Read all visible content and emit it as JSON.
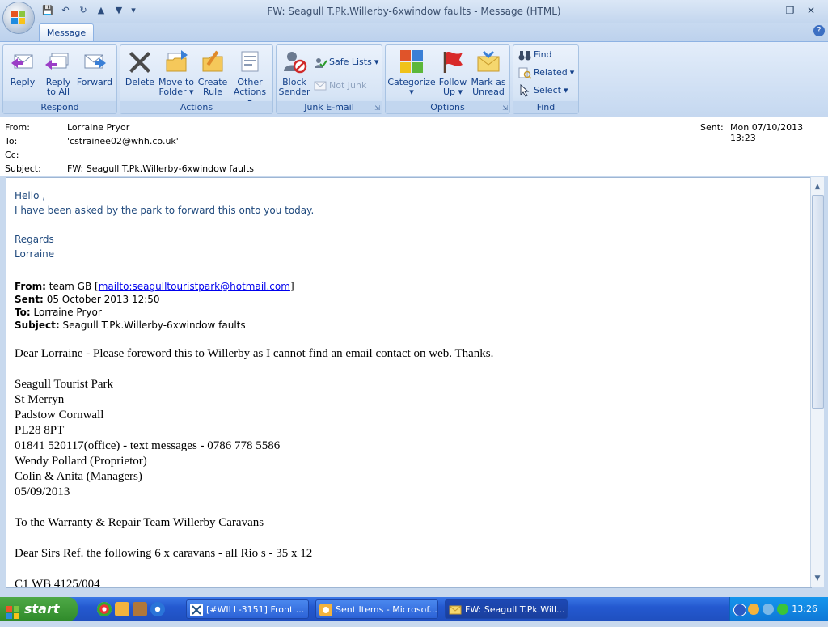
{
  "window": {
    "title": "FW: Seagull T.Pk.Willerby-6xwindow faults - Message (HTML)",
    "tab": "Message"
  },
  "ribbon": {
    "respond": {
      "label": "Respond",
      "reply": "Reply",
      "reply_all_1": "Reply",
      "reply_all_2": "to All",
      "forward": "Forward"
    },
    "actions": {
      "label": "Actions",
      "delete": "Delete",
      "move_1": "Move to",
      "move_2": "Folder",
      "create_1": "Create",
      "create_2": "Rule",
      "other_1": "Other",
      "other_2": "Actions"
    },
    "junk": {
      "label": "Junk E-mail",
      "block_1": "Block",
      "block_2": "Sender",
      "safe_lists": "Safe Lists",
      "not_junk": "Not Junk"
    },
    "options": {
      "label": "Options",
      "categorize": "Categorize",
      "follow_1": "Follow",
      "follow_2": "Up",
      "mark_1": "Mark as",
      "mark_2": "Unread"
    },
    "find": {
      "label": "Find",
      "find": "Find",
      "related": "Related",
      "select": "Select"
    }
  },
  "header": {
    "from_label": "From:",
    "from": "Lorraine Pryor",
    "to_label": "To:",
    "to": "'cstrainee02@whh.co.uk'",
    "cc_label": "Cc:",
    "cc": "",
    "subject_label": "Subject:",
    "subject": "FW: Seagull T.Pk.Willerby-6xwindow faults",
    "sent_label": "Sent:",
    "sent": "Mon 07/10/2013 13:23"
  },
  "body": {
    "intro": [
      "Hello ,",
      "I have been asked by the park to forward this onto you today.",
      "Regards",
      "Lorraine"
    ],
    "forwarded": {
      "from_label": "From:",
      "from_name": "team GB [",
      "from_link": "mailto:seagulltouristpark@hotmail.com",
      "from_end": "]",
      "sent_label": "Sent:",
      "sent": "05 October 2013 12:50",
      "to_label": "To:",
      "to": "Lorraine Pryor",
      "subject_label": "Subject:",
      "subject": "Seagull T.Pk.Willerby-6xwindow faults"
    },
    "lines": [
      "Dear Lorraine - Please foreword this to Willerby as I cannot find an email contact on web. Thanks.",
      "Seagull Tourist Park",
      "St Merryn",
      "Padstow Cornwall",
      "PL28 8PT",
      "01841 520117(office) - text messages - 0786 778 5586",
      "Wendy Pollard (Proprietor)",
      "Colin & Anita (Managers)",
      "05/09/2013",
      "To the Warranty & Repair Team Willerby Caravans",
      "Dear Sirs  Ref. the following 6 x caravans - all Rio s - 35 x 12",
      "C1     WB 4125/004"
    ]
  },
  "taskbar": {
    "start": "start",
    "items": [
      "[#WILL-3151] Front ...",
      "Sent Items - Microsof...",
      "FW: Seagull T.Pk.Will..."
    ],
    "clock": "13:26"
  },
  "colors": {
    "ribbon_bg": "#dbe7f6",
    "body_text_blue": "#1f497d",
    "taskbar_blue": "#2459d0",
    "start_green": "#3a9a34"
  }
}
